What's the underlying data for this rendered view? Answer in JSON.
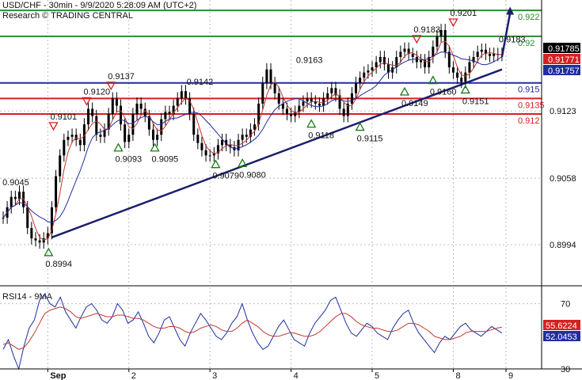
{
  "header": {
    "title": "USD/CHF - 30min - 9/9/2020 5:28:09 AM (UTC+2)",
    "source": "Research © TRADING CENTRAL"
  },
  "colors": {
    "resistance_green": "#2e8b2e",
    "pivot_blue": "#1f2e9e",
    "support_red": "#d62020",
    "trendline": "#1a1f6b",
    "price_bars": "#000000",
    "ma_fast": "#c0392b",
    "ma_slow": "#1f2e9e",
    "rsi_line": "#1f2e9e",
    "rsi_ma": "#c0392b",
    "last_price_bg": "#000000",
    "red_tag_bg": "#d62020",
    "blue_tag_bg": "#1f2e9e",
    "grid": "#bdbdbd"
  },
  "chart_data": [
    {
      "type": "candlestick",
      "title": "USD/CHF - 30min",
      "yaxis_ticks": [
        "0.8994",
        "0.9058",
        "0.9123"
      ],
      "x_ticks": [
        "Sep",
        "2",
        "3",
        "4",
        "5",
        "8",
        "9"
      ],
      "ylim": [
        0.8955,
        0.923
      ],
      "levels": [
        {
          "kind": "resistance",
          "value": 0.922,
          "label": "0.922"
        },
        {
          "kind": "resistance",
          "value": 0.9195,
          "label": "0.92"
        },
        {
          "kind": "pivot",
          "value": 0.915,
          "label": "0.915"
        },
        {
          "kind": "support",
          "value": 0.9135,
          "label": "0.9135"
        },
        {
          "kind": "support",
          "value": 0.912,
          "label": "0.912"
        }
      ],
      "price_tags": [
        {
          "label": "0.91785",
          "kind": "last",
          "value": 0.91785
        },
        {
          "label": "0.91771",
          "kind": "red",
          "value": 0.91771
        },
        {
          "label": "0.91757",
          "kind": "blue",
          "value": 0.91757
        }
      ],
      "annotations": [
        {
          "label": "0.9045",
          "marker": "none",
          "x": 0.03,
          "y": 0.9045
        },
        {
          "label": "0.8994",
          "marker": "up",
          "x": 0.56,
          "y": 0.8994
        },
        {
          "label": "0.9101",
          "marker": "down",
          "x": 0.62,
          "y": 0.9101
        },
        {
          "label": "0.9120",
          "marker": "down",
          "x": 1.03,
          "y": 0.9125
        },
        {
          "label": "0.9137",
          "marker": "down",
          "x": 1.33,
          "y": 0.914
        },
        {
          "label": "0.9093",
          "marker": "up",
          "x": 1.42,
          "y": 0.9095
        },
        {
          "label": "0.9095",
          "marker": "up",
          "x": 1.87,
          "y": 0.9095
        },
        {
          "label": "0.9142",
          "marker": "none",
          "x": 2.3,
          "y": 0.9142
        },
        {
          "label": "0.9079",
          "marker": "up",
          "x": 2.62,
          "y": 0.9079
        },
        {
          "label": "0.9080",
          "marker": "up",
          "x": 2.95,
          "y": 0.908
        },
        {
          "label": "0.9163",
          "marker": "none",
          "x": 3.65,
          "y": 0.9163
        },
        {
          "label": "0.9118",
          "marker": "up",
          "x": 3.8,
          "y": 0.9118
        },
        {
          "label": "0.9115",
          "marker": "up",
          "x": 4.4,
          "y": 0.9115
        },
        {
          "label": "0.9149",
          "marker": "up",
          "x": 4.95,
          "y": 0.9149
        },
        {
          "label": "0.9183",
          "marker": "down",
          "x": 5.1,
          "y": 0.9185
        },
        {
          "label": "0.9201",
          "marker": "down",
          "x": 5.55,
          "y": 0.9201
        },
        {
          "label": "0.9160",
          "marker": "up",
          "x": 5.3,
          "y": 0.916
        },
        {
          "label": "0.9151",
          "marker": "up",
          "x": 5.7,
          "y": 0.9151
        },
        {
          "label": "0.9183",
          "marker": "none",
          "x": 6.15,
          "y": 0.9183
        }
      ],
      "trendline": {
        "from": [
          0.6,
          0.9001
        ],
        "to": [
          6.15,
          0.9163
        ]
      },
      "projection_arrow": {
        "from": [
          6.15,
          0.9175
        ],
        "to": [
          6.25,
          0.9222
        ]
      },
      "series": [
        {
          "name": "price",
          "x": [
            0.0,
            0.05,
            0.1,
            0.15,
            0.2,
            0.25,
            0.3,
            0.35,
            0.4,
            0.45,
            0.5,
            0.55,
            0.6,
            0.65,
            0.7,
            0.75,
            0.8,
            0.85,
            0.9,
            0.95,
            1.0,
            1.05,
            1.1,
            1.15,
            1.2,
            1.25,
            1.3,
            1.35,
            1.4,
            1.45,
            1.5,
            1.55,
            1.6,
            1.65,
            1.7,
            1.75,
            1.8,
            1.85,
            1.9,
            1.95,
            2.0,
            2.05,
            2.1,
            2.15,
            2.2,
            2.25,
            2.3,
            2.35,
            2.4,
            2.45,
            2.5,
            2.55,
            2.6,
            2.65,
            2.7,
            2.75,
            2.8,
            2.85,
            2.9,
            2.95,
            3.0,
            3.05,
            3.1,
            3.15,
            3.2,
            3.25,
            3.3,
            3.35,
            3.4,
            3.45,
            3.5,
            3.55,
            3.6,
            3.65,
            3.7,
            3.75,
            3.8,
            3.85,
            3.9,
            3.95,
            4.0,
            4.05,
            4.1,
            4.15,
            4.2,
            4.25,
            4.3,
            4.35,
            4.4,
            4.45,
            4.5,
            4.55,
            4.6,
            4.65,
            4.7,
            4.75,
            4.8,
            4.85,
            4.9,
            4.95,
            5.0,
            5.05,
            5.1,
            5.15,
            5.2,
            5.25,
            5.3,
            5.35,
            5.4,
            5.45,
            5.5,
            5.55,
            5.6,
            5.65,
            5.7,
            5.75,
            5.8,
            5.85,
            5.9,
            5.95,
            6.0,
            6.05,
            6.1,
            6.15
          ],
          "values": [
            0.902,
            0.903,
            0.904,
            0.9038,
            0.9045,
            0.903,
            0.901,
            0.9,
            0.8998,
            0.8996,
            0.9,
            0.9005,
            0.903,
            0.906,
            0.908,
            0.9095,
            0.9098,
            0.91,
            0.9095,
            0.909,
            0.911,
            0.9125,
            0.9118,
            0.91,
            0.9098,
            0.9105,
            0.912,
            0.9135,
            0.9128,
            0.911,
            0.9093,
            0.91,
            0.912,
            0.913,
            0.9125,
            0.9118,
            0.9105,
            0.9095,
            0.91,
            0.9115,
            0.9122,
            0.912,
            0.9128,
            0.9135,
            0.9142,
            0.9135,
            0.912,
            0.91,
            0.9092,
            0.9085,
            0.908,
            0.908,
            0.9082,
            0.909,
            0.9095,
            0.909,
            0.9088,
            0.9085,
            0.9095,
            0.91,
            0.9098,
            0.9105,
            0.911,
            0.913,
            0.915,
            0.9163,
            0.915,
            0.914,
            0.913,
            0.9125,
            0.912,
            0.9118,
            0.9122,
            0.9128,
            0.9132,
            0.9135,
            0.9132,
            0.913,
            0.9128,
            0.9135,
            0.914,
            0.9145,
            0.9138,
            0.9125,
            0.9118,
            0.913,
            0.914,
            0.915,
            0.9155,
            0.916,
            0.9162,
            0.9165,
            0.917,
            0.9175,
            0.9168,
            0.916,
            0.9165,
            0.9175,
            0.918,
            0.9183,
            0.9178,
            0.9175,
            0.917,
            0.9172,
            0.9165,
            0.9175,
            0.9185,
            0.9195,
            0.9201,
            0.918,
            0.9165,
            0.916,
            0.9155,
            0.9151,
            0.916,
            0.917,
            0.9175,
            0.918,
            0.9182,
            0.9178,
            0.9176,
            0.9178,
            0.9177,
            0.9178
          ]
        }
      ]
    },
    {
      "type": "line",
      "title": "RSI14 - 9MA",
      "yaxis_ticks": [
        "70",
        "30"
      ],
      "ylim": [
        30,
        80
      ],
      "price_tags": [
        {
          "label": "55.6224",
          "kind": "red",
          "value": 55.6224
        },
        {
          "label": "52.0453",
          "kind": "blue",
          "value": 52.0453
        }
      ],
      "series": [
        {
          "name": "RSI14",
          "values": [
            42,
            48,
            38,
            30,
            44,
            55,
            60,
            72,
            76,
            70,
            68,
            74,
            65,
            60,
            55,
            62,
            68,
            70,
            66,
            60,
            58,
            62,
            70,
            66,
            58,
            60,
            65,
            58,
            50,
            46,
            52,
            60,
            62,
            55,
            48,
            44,
            52,
            58,
            64,
            60,
            55,
            50,
            48,
            52,
            58,
            62,
            70,
            60,
            52,
            46,
            42,
            44,
            50,
            56,
            60,
            54,
            48,
            46,
            44,
            52,
            58,
            62,
            66,
            72,
            74,
            66,
            58,
            52,
            50,
            54,
            58,
            56,
            52,
            50,
            48,
            55,
            60,
            64,
            66,
            58,
            52,
            48,
            44,
            40,
            46,
            50,
            48,
            52,
            56,
            58,
            54,
            52,
            50,
            53,
            56,
            54,
            52
          ]
        },
        {
          "name": "9MA",
          "values": [
            45,
            46,
            44,
            42,
            43,
            47,
            52,
            58,
            64,
            66,
            67,
            68,
            67,
            65,
            62,
            61,
            62,
            63,
            64,
            63,
            62,
            62,
            63,
            63,
            62,
            61,
            61,
            60,
            58,
            56,
            55,
            55,
            56,
            56,
            55,
            53,
            52,
            53,
            55,
            56,
            57,
            56,
            54,
            53,
            53,
            55,
            58,
            60,
            58,
            56,
            53,
            51,
            50,
            50,
            51,
            52,
            52,
            51,
            50,
            50,
            51,
            53,
            56,
            59,
            62,
            64,
            64,
            62,
            59,
            57,
            56,
            55,
            55,
            54,
            53,
            53,
            54,
            56,
            58,
            58,
            57,
            55,
            53,
            50,
            49,
            48,
            48,
            49,
            50,
            52,
            53,
            53,
            53,
            53,
            54,
            55,
            55.6
          ]
        }
      ]
    }
  ]
}
